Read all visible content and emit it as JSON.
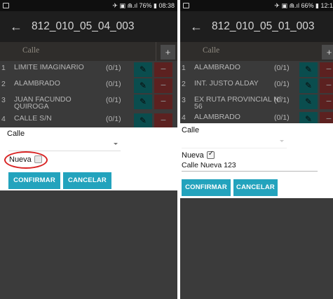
{
  "left": {
    "status": {
      "right": "✈ ▣ ⋒.ıl 76% ▮ 08:38"
    },
    "appbar": {
      "back": "←",
      "title": "812_010_05_04_003"
    },
    "grid": {
      "header": "Calle",
      "add": "+",
      "rows": [
        {
          "num": "1",
          "name": "LIMITE IMAGINARIO",
          "count": "(0/1)"
        },
        {
          "num": "2",
          "name": "ALAMBRADO",
          "count": "(0/1)"
        },
        {
          "num": "3",
          "name": "JUAN FACUNDO QUIROGA",
          "count": "(0/1)"
        },
        {
          "num": "4",
          "name": "CALLE S/N",
          "count": "(0/1)"
        }
      ]
    },
    "form": {
      "calle_label": "Calle",
      "nueva_label": "Nueva",
      "confirm": "CONFIRMAR",
      "cancel": "CANCELAR"
    }
  },
  "right": {
    "status": {
      "right": "✈ ▣ ⋒.ıl 66% ▮ 12:1"
    },
    "appbar": {
      "back": "←",
      "title": "812_010_05_01_003"
    },
    "grid": {
      "header": "Calle",
      "add": "+",
      "rows": [
        {
          "num": "1",
          "name": "ALAMBRADO",
          "count": "(0/1)"
        },
        {
          "num": "2",
          "name": "INT. JUSTO ALDAY",
          "count": "(0/1)"
        },
        {
          "num": "3",
          "name": "EX RUTA PROVINCIAL N°",
          "count": "(0/1)",
          "name2": "56"
        },
        {
          "num": "4",
          "name": "ALAMBRADO",
          "count": "(0/1)"
        }
      ]
    },
    "form": {
      "calle_label": "Calle",
      "nueva_label": "Nueva",
      "street_value": "Calle Nueva 123",
      "confirm": "CONFIRMAR",
      "cancel": "CANCELAR"
    }
  },
  "icons": {
    "edit": "✎",
    "delete": "−",
    "check": "✓"
  },
  "colors": {
    "accent": "#23a3bd",
    "edit": "#0a4d4e",
    "delete": "#5c2120",
    "highlight": "#d82323"
  }
}
